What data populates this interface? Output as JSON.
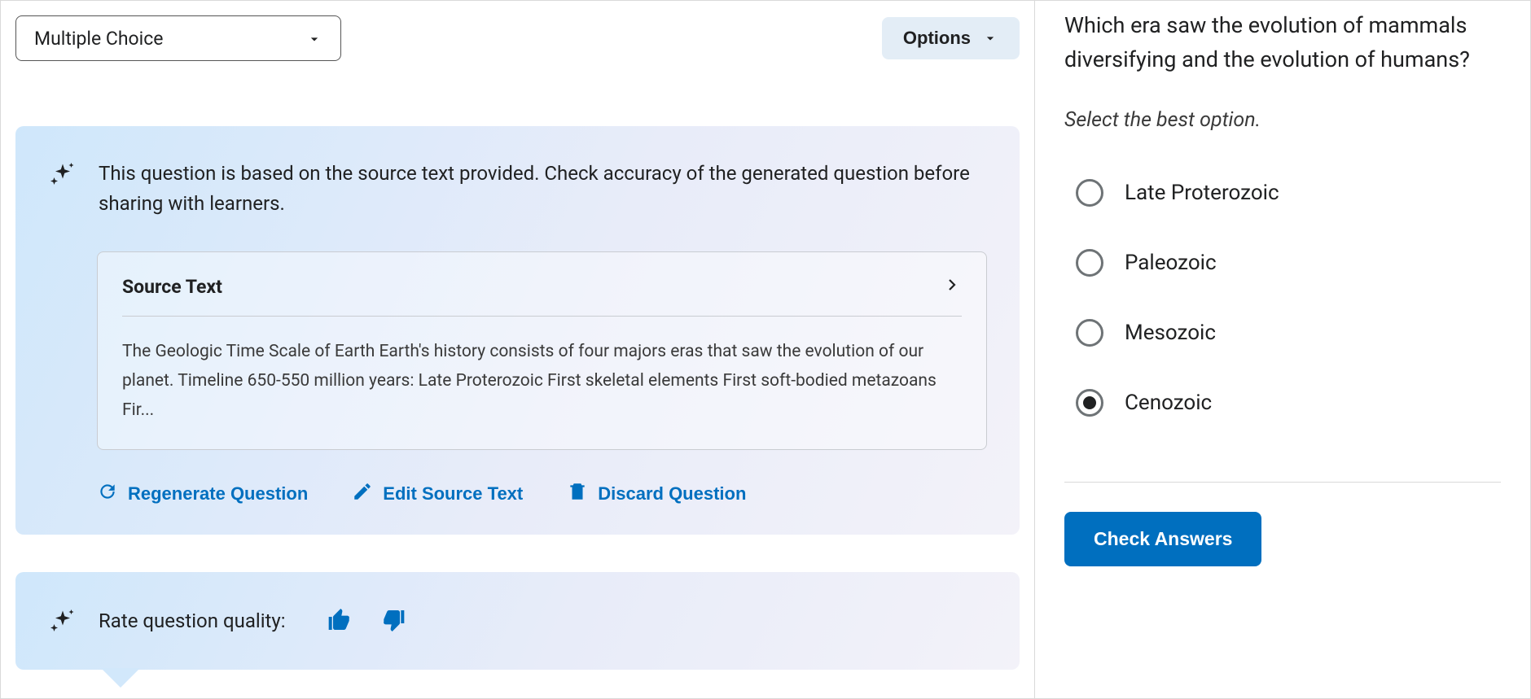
{
  "toolbar": {
    "question_type": "Multiple Choice",
    "options_label": "Options"
  },
  "ai_card": {
    "info_text": "This question is based on the source text provided. Check accuracy of the generated question before sharing with learners.",
    "source_title": "Source Text",
    "source_body": "The Geologic Time Scale of Earth Earth's history consists of four majors eras that saw the evolution of our planet. Timeline 650-550 million years: Late Proterozoic First skeletal elements First soft-bodied metazoans Fir...",
    "actions": {
      "regenerate": "Regenerate Question",
      "edit_source": "Edit Source Text",
      "discard": "Discard Question"
    }
  },
  "rate": {
    "label": "Rate question quality:"
  },
  "preview": {
    "question": "Which era saw the evolution of mammals diversifying and the evolution of humans?",
    "instruction": "Select the best option.",
    "options": {
      "0": "Late Proterozoic",
      "1": "Paleozoic",
      "2": "Mesozoic",
      "3": "Cenozoic"
    },
    "selected_index": 3,
    "check_label": "Check Answers"
  }
}
